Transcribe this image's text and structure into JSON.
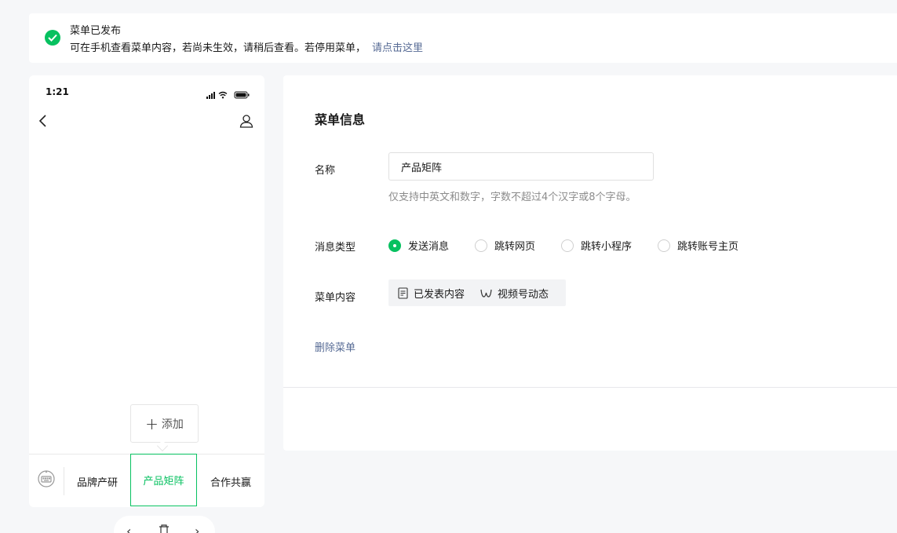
{
  "notice": {
    "title": "菜单已发布",
    "description": "可在手机查看菜单内容，若尚未生效，请稍后查看。若停用菜单，",
    "link": "请点击这里"
  },
  "phone": {
    "time": "1:21",
    "add_label": "添加",
    "menu_items": [
      {
        "label": "品牌产研",
        "selected": false
      },
      {
        "label": "产品矩阵",
        "selected": true
      },
      {
        "label": "合作共赢",
        "selected": false
      }
    ]
  },
  "form": {
    "section_title": "菜单信息",
    "name_label": "名称",
    "name_value": "产品矩阵",
    "name_hint": "仅支持中英文和数字，字数不超过4个汉字或8个字母。",
    "type_label": "消息类型",
    "type_options": [
      {
        "label": "发送消息",
        "checked": true
      },
      {
        "label": "跳转网页",
        "checked": false
      },
      {
        "label": "跳转小程序",
        "checked": false
      },
      {
        "label": "跳转账号主页",
        "checked": false
      }
    ],
    "content_label": "菜单内容",
    "content_tabs": [
      "已发表内容",
      "视频号动态"
    ],
    "delete_label": "删除菜单"
  },
  "colors": {
    "accent": "#07c160",
    "link": "#576b95",
    "hint": "#8c8c8c"
  },
  "icons": [
    "check-circle-icon",
    "chevron-left-icon",
    "user-icon",
    "keyboard-icon",
    "plus-icon",
    "document-icon",
    "channels-icon"
  ]
}
